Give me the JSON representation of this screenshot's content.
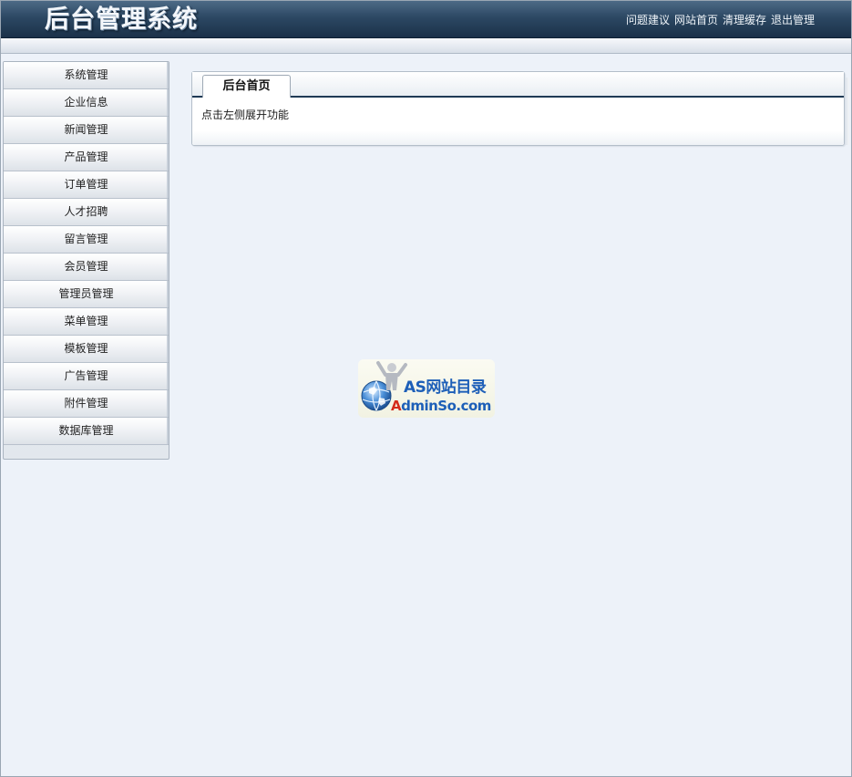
{
  "header": {
    "title": "后台管理系统",
    "links": [
      "问题建议",
      "网站首页",
      "清理缓存",
      "退出管理"
    ]
  },
  "sidebar": {
    "items": [
      {
        "label": "系统管理"
      },
      {
        "label": "企业信息"
      },
      {
        "label": "新闻管理"
      },
      {
        "label": "产品管理"
      },
      {
        "label": "订单管理"
      },
      {
        "label": "人才招聘"
      },
      {
        "label": "留言管理"
      },
      {
        "label": "会员管理"
      },
      {
        "label": "管理员管理"
      },
      {
        "label": "菜单管理"
      },
      {
        "label": "模板管理"
      },
      {
        "label": "广告管理"
      },
      {
        "label": "附件管理"
      },
      {
        "label": "数据库管理"
      }
    ]
  },
  "main": {
    "tab_label": "后台首页",
    "body_text": "点击左侧展开功能"
  },
  "watermark": {
    "line1": "AS网站目录",
    "line2_first": "A",
    "line2_rest": "dminSo.com"
  },
  "colors": {
    "header_bg": "#2c4863",
    "page_bg": "#edf2f9",
    "tab_underline": "#1f3a55",
    "logo_blue": "#1d5fb8",
    "logo_red": "#d42a1a"
  }
}
